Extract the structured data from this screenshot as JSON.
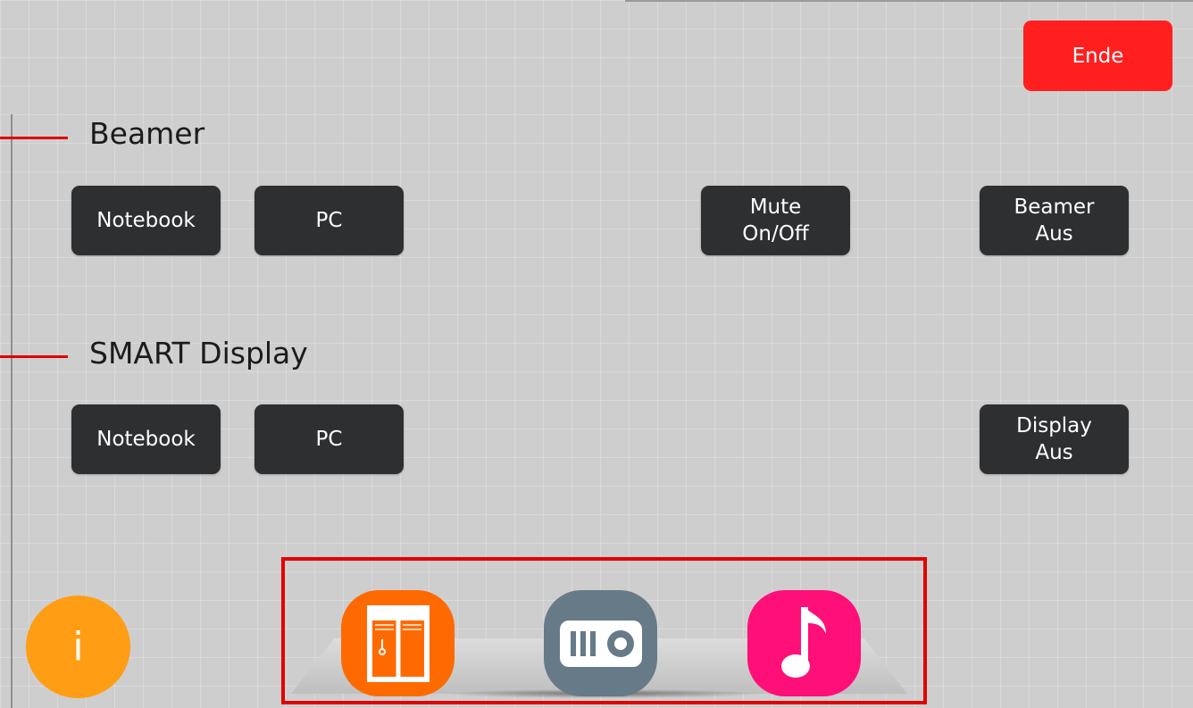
{
  "header": {
    "end_button_label": "Ende"
  },
  "sections": [
    {
      "title": "Beamer",
      "buttons": [
        {
          "label": "Notebook"
        },
        {
          "label": "PC"
        },
        {
          "label": "Mute\nOn/Off"
        },
        {
          "label": "Beamer\nAus"
        }
      ]
    },
    {
      "title": "SMART Display",
      "buttons": [
        {
          "label": "Notebook"
        },
        {
          "label": "PC"
        },
        {
          "label": "Display\nAus"
        }
      ]
    }
  ],
  "info_button": {
    "label": "i",
    "color": "#ff9d14"
  },
  "dock": {
    "apps": [
      {
        "icon": "blinds-icon",
        "color": "#ff6a00"
      },
      {
        "icon": "projector-icon",
        "color": "#667a88"
      },
      {
        "icon": "music-note-icon",
        "color": "#ff0f78"
      }
    ]
  },
  "colors": {
    "background": "#cecece",
    "button": "#2e2f31",
    "end_button": "#ff1f1f",
    "accent_line": "#e00000"
  }
}
